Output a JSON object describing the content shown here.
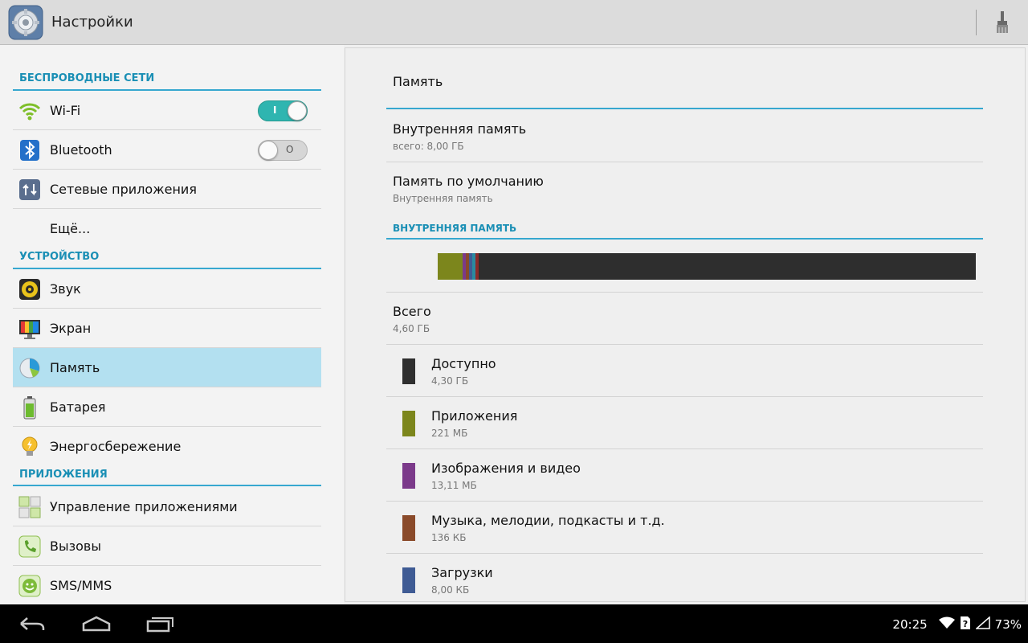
{
  "app": {
    "title": "Настройки",
    "icon": "settings-gear-icon",
    "actions": [
      {
        "icon": "brush-icon"
      }
    ]
  },
  "sidebar": {
    "categories": [
      {
        "label": "БЕСПРОВОДНЫЕ СЕТИ"
      },
      {
        "label": "УСТРОЙСТВО"
      },
      {
        "label": "ПРИЛОЖЕНИЯ"
      }
    ],
    "items": [
      {
        "label": "Wi-Fi",
        "icon": "wifi-icon",
        "toggle": "on",
        "toggle_mark": "I"
      },
      {
        "label": "Bluetooth",
        "icon": "bluetooth-icon",
        "toggle": "off",
        "toggle_mark": "O"
      },
      {
        "label": "Сетевые приложения",
        "icon": "network-apps-icon"
      },
      {
        "label": "Ещё..."
      },
      {
        "label": "Звук",
        "icon": "speaker-icon"
      },
      {
        "label": "Экран",
        "icon": "display-icon"
      },
      {
        "label": "Память",
        "icon": "storage-pie-icon",
        "selected": true
      },
      {
        "label": "Батарея",
        "icon": "battery-icon"
      },
      {
        "label": "Энергосбережение",
        "icon": "power-saving-bulb-icon"
      },
      {
        "label": "Управление приложениями",
        "icon": "app-manager-icon"
      },
      {
        "label": "Вызовы",
        "icon": "phone-icon"
      },
      {
        "label": "SMS/MMS",
        "icon": "sms-icon"
      }
    ]
  },
  "main": {
    "title": "Память",
    "prefs": [
      {
        "title": "Внутренняя память",
        "summary": "всего: 8,00  ГБ"
      },
      {
        "title": "Память по умолчанию",
        "summary": "Внутренняя память"
      }
    ],
    "section_label": "ВНУТРЕННЯЯ ПАМЯТЬ",
    "total": {
      "title": "Всего",
      "summary": "4,60 ГБ"
    },
    "usage_bar": [
      {
        "name": "Приложения",
        "fraction": 0.046,
        "color": "#7c861c"
      },
      {
        "name": "Изображения и видео",
        "fraction": 0.006,
        "color": "#7b3a8a"
      },
      {
        "name": "Музыка, мелодии, подкасты и т.д.",
        "fraction": 0.006,
        "color": "#8a4a2a"
      },
      {
        "name": "Загрузки",
        "fraction": 0.006,
        "color": "#3f5b94"
      },
      {
        "name": "extra-1",
        "fraction": 0.006,
        "color": "#2a8aa0"
      },
      {
        "name": "extra-2",
        "fraction": 0.006,
        "color": "#8a2a2a"
      }
    ],
    "legend": [
      {
        "title": "Доступно",
        "summary": "4,30 ГБ",
        "color": "#2f2f2f"
      },
      {
        "title": "Приложения",
        "summary": "221 МБ",
        "color": "#7c861c"
      },
      {
        "title": "Изображения и видео",
        "summary": "13,11 МБ",
        "color": "#7b3a8a"
      },
      {
        "title": "Музыка, мелодии, подкасты и т.д.",
        "summary": "136 КБ",
        "color": "#8a4a2a"
      },
      {
        "title": "Загрузки",
        "summary": "8,00 КБ",
        "color": "#3f5b94"
      }
    ]
  },
  "navbar": {
    "buttons": [
      {
        "icon": "back-icon"
      },
      {
        "icon": "home-icon"
      },
      {
        "icon": "recent-apps-icon"
      }
    ],
    "status": {
      "time": "20:25",
      "battery": "73%"
    }
  }
}
